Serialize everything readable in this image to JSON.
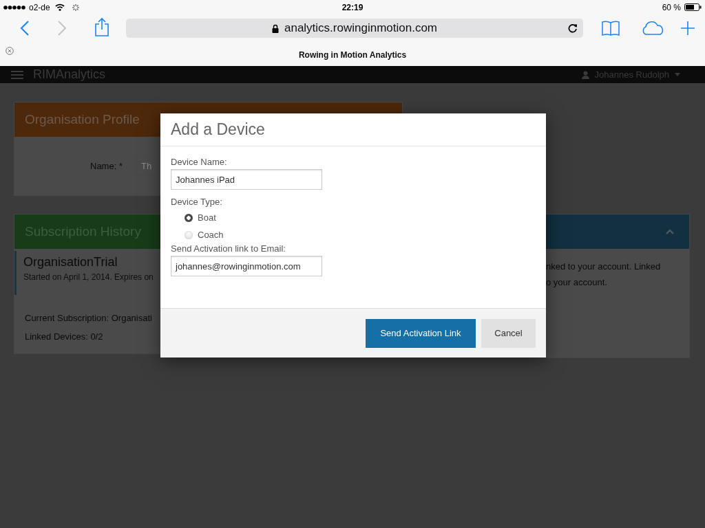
{
  "status_bar": {
    "carrier": "o2-de",
    "time": "22:19",
    "battery": "60 %"
  },
  "browser": {
    "url": "analytics.rowinginmotion.com",
    "tab_title": "Rowing in Motion Analytics"
  },
  "app_nav": {
    "brand": "RIMAnalytics",
    "user": "Johannes Rudolph"
  },
  "organisation_profile": {
    "title": "Organisation Profile",
    "name_label": "Name: *",
    "name_value": "Th"
  },
  "subscription_history": {
    "title": "Subscription History",
    "plan": "OrganisationTrial",
    "dates": "Started on April 1, 2014. Expires on",
    "current": "Current Subscription: Organisati",
    "linked": "Linked Devices: 0/2"
  },
  "devices_panel": {
    "lines": [
      "nked to your account. Linked",
      "o your account."
    ]
  },
  "modal": {
    "title": "Add a Device",
    "device_name": {
      "label": "Device Name:",
      "value": "Johannes iPad"
    },
    "device_type": {
      "label": "Device Type:",
      "options": [
        {
          "label": "Boat",
          "selected": true
        },
        {
          "label": "Coach",
          "selected": false
        }
      ]
    },
    "email": {
      "label": "Send Activation link to Email:",
      "value": "johannes@rowinginmotion.com"
    },
    "buttons": [
      {
        "label": "Send Activation Link",
        "kind": "primary"
      },
      {
        "label": "Cancel",
        "kind": "default"
      }
    ]
  }
}
